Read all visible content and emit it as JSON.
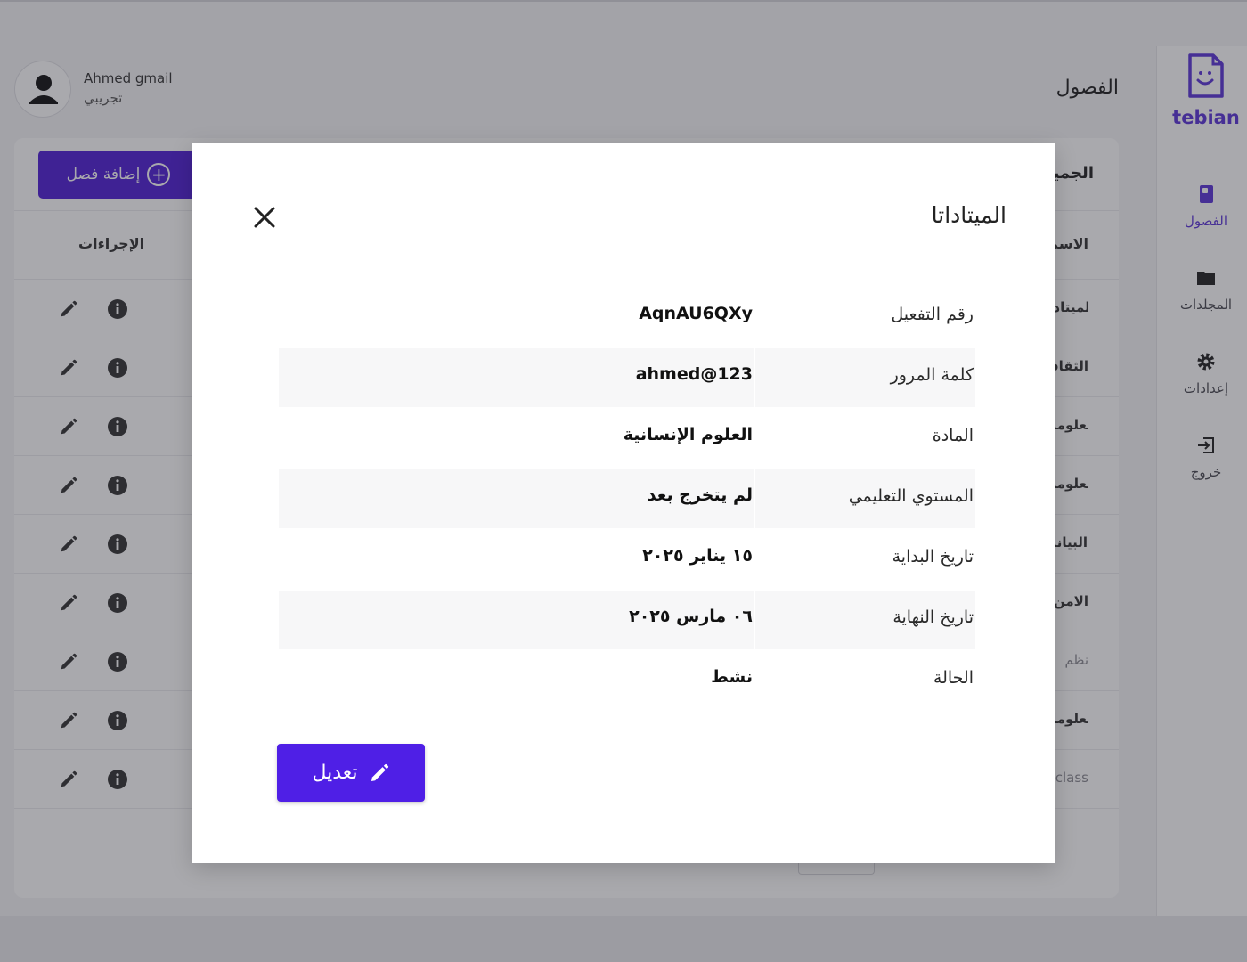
{
  "app": {
    "brand": "tebian",
    "page_title": "الفصول",
    "accent_color": "#5b35d8",
    "button_color": "#4f1fe6"
  },
  "user": {
    "name": "Ahmed gmail",
    "role": "تجريبي"
  },
  "sidebar": {
    "items": [
      {
        "label": "الفصول",
        "icon": "book-icon",
        "active": true
      },
      {
        "label": "المجلدات",
        "icon": "folder-icon",
        "active": false
      },
      {
        "label": "إعدادات",
        "icon": "gear-icon",
        "active": false
      },
      {
        "label": "خروج",
        "icon": "logout-icon",
        "active": false
      }
    ]
  },
  "toolbar": {
    "add_label": "إضافة فصل",
    "heading": "الجميع"
  },
  "table": {
    "col_name": "الاسم",
    "col_actions": "الإجراءات",
    "rows": [
      {
        "name": "الميتاداتا",
        "muted": false
      },
      {
        "name": "الثقافة",
        "muted": false
      },
      {
        "name": "نظم المعلومات",
        "muted": false
      },
      {
        "name": "امن المعلومات",
        "muted": false
      },
      {
        "name": "علم البيانات",
        "muted": false
      },
      {
        "name": "الامن",
        "muted": false
      },
      {
        "name": "نظم",
        "muted": true
      },
      {
        "name": "معلومات",
        "muted": false
      },
      {
        "name": "class",
        "muted": true
      }
    ]
  },
  "modal": {
    "title": "الميتاداتا",
    "edit_label": "تعديل",
    "fields": [
      {
        "label": "رقم التفعيل",
        "value": "AqnAU6QXy"
      },
      {
        "label": "كلمة المرور",
        "value": "ahmed@123"
      },
      {
        "label": "المادة",
        "value": "العلوم الإنسانية"
      },
      {
        "label": "المستوي التعليمي",
        "value": "لم يتخرج بعد"
      },
      {
        "label": "تاريخ البداية",
        "value": "١٥ يناير ٢٠٢٥"
      },
      {
        "label": "تاريخ النهاية",
        "value": "٠٦ مارس ٢٠٢٥"
      },
      {
        "label": "الحالة",
        "value": "نشط"
      }
    ]
  }
}
